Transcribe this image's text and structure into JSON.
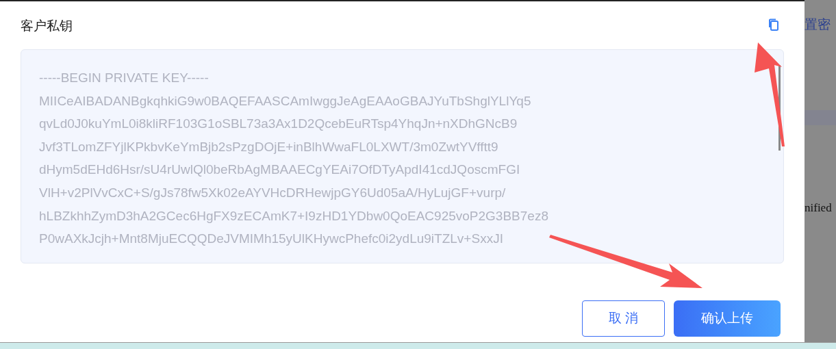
{
  "dialog": {
    "title": "客户私钥",
    "key_lines": [
      "-----BEGIN PRIVATE KEY-----",
      "MIICeAIBADANBgkqhkiG9w0BAQEFAASCAmIwggJeAgEAAoGBAJYuTbShglYLlYq5",
      "qvLd0J0kuYmL0i8kliRF103G1oSBL73a3Ax1D2QcebEuRTsp4YhqJn+nXDhGNcB9",
      "Jvf3TLomZFYjlKPkbvKeYmBjb2sPzgDOjE+inBlhWwaFL0LXWT/3m0ZwtYVfftt9",
      "dHym5dEHd6Hsr/sU4rUwlQl0beRbAgMBAAECgYEAi7OfDTyApdI41cdJQoscmFGI",
      "VlH+v2PlVvCxC+S/gJs78fw5Xk02eAYVHcDRHewjpGY6Ud05aA/HyLujGF+vurp/",
      "hLBZkhhZymD3hA2GCec6HgFX9zECAmK7+I9zHD1YDbw0QoEAC925voP2G3BB7ez8",
      "P0wAXkJcjh+Mnt8MjuECQQDeJVMIMh15yUlKHywcPhefc0i2ydLu9iTZLv+SxxJI"
    ],
    "buttons": [
      {
        "kind": "secondary",
        "label": "取 消"
      },
      {
        "kind": "primary",
        "label": "确认上传"
      }
    ]
  },
  "background": {
    "texts": [
      "置密",
      "nified"
    ]
  }
}
